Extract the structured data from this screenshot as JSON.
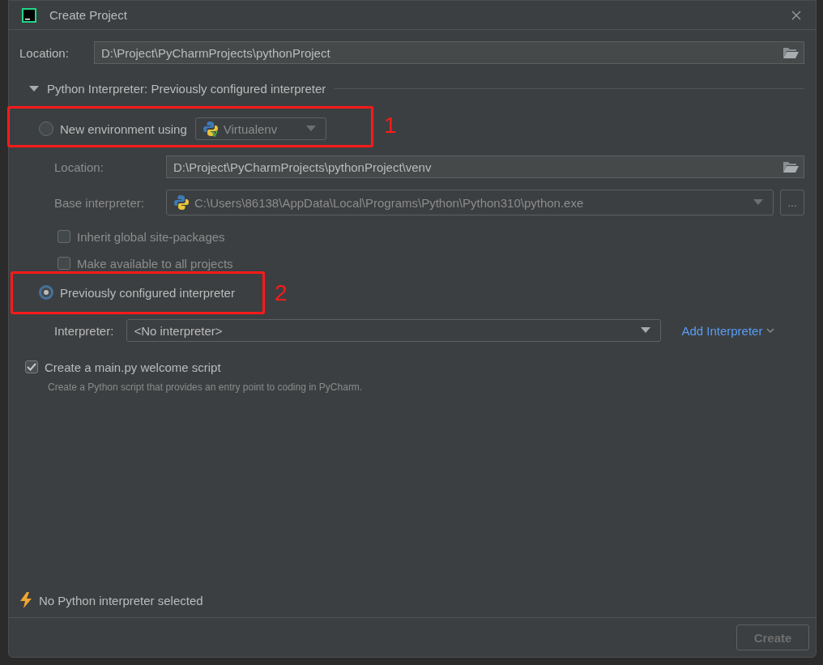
{
  "window": {
    "title": "Create Project"
  },
  "location": {
    "label": "Location:",
    "value": "D:\\Project\\PyCharmProjects\\pythonProject"
  },
  "interpreter_section": {
    "title": "Python Interpreter: Previously configured interpreter",
    "expanded": true
  },
  "radios": [
    {
      "label": "New environment using",
      "selected": false
    },
    {
      "label": "Previously configured interpreter",
      "selected": true
    }
  ],
  "new_environment": {
    "tool": "Virtualenv",
    "location_label": "Location:",
    "location_value": "D:\\Project\\PyCharmProjects\\pythonProject\\venv",
    "base_label": "Base interpreter:",
    "base_value": "C:\\Users\\86138\\AppData\\Local\\Programs\\Python\\Python310\\python.exe",
    "browse": "...",
    "checkboxes": [
      {
        "label": "Inherit global site-packages",
        "checked": false
      },
      {
        "label": "Make available to all projects",
        "checked": false
      }
    ]
  },
  "previous": {
    "interpreter_label": "Interpreter:",
    "interpreter_value": "<No interpreter>",
    "link": "Add Interpreter"
  },
  "welcome_script": {
    "label": "Create a main.py welcome script",
    "checked": true,
    "hint": "Create a Python script that provides an entry point to coding in PyCharm."
  },
  "status": {
    "message": "No Python interpreter selected"
  },
  "buttons": [
    {
      "label": "Create",
      "disabled": true
    }
  ],
  "annotations": [
    {
      "label": "1"
    },
    {
      "label": "2"
    }
  ]
}
